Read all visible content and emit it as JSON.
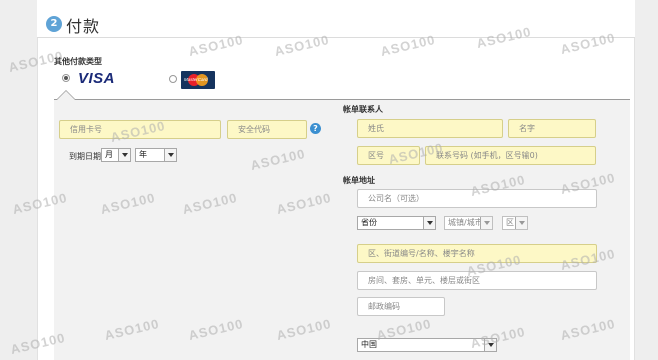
{
  "header": {
    "step_number": "2",
    "title": "付款"
  },
  "payment_types": {
    "title": "其他付款类型",
    "visa_label": "VISA",
    "mastercard_label": "MasterCard"
  },
  "card": {
    "number_placeholder": "信用卡号",
    "security_placeholder": "安全代码",
    "help_symbol": "?",
    "expiry_label": "到期日期",
    "month_value": "月",
    "year_value": "年"
  },
  "contact": {
    "title": "帐单联系人",
    "last_name": "姓氏",
    "first_name": "名字",
    "area_code": "区号",
    "phone": "联系号码 (如手机，区号输0)"
  },
  "address": {
    "title": "帐单地址",
    "company": "公司名（可选）",
    "province": "省份",
    "city": "城镇/城市",
    "district": "区",
    "street": "区、街道编号/名称、楼宇名称",
    "room": "房间、套房、单元、楼层或街区",
    "postcode": "邮政编码",
    "country": "中国"
  },
  "watermark_text": "ASO100"
}
